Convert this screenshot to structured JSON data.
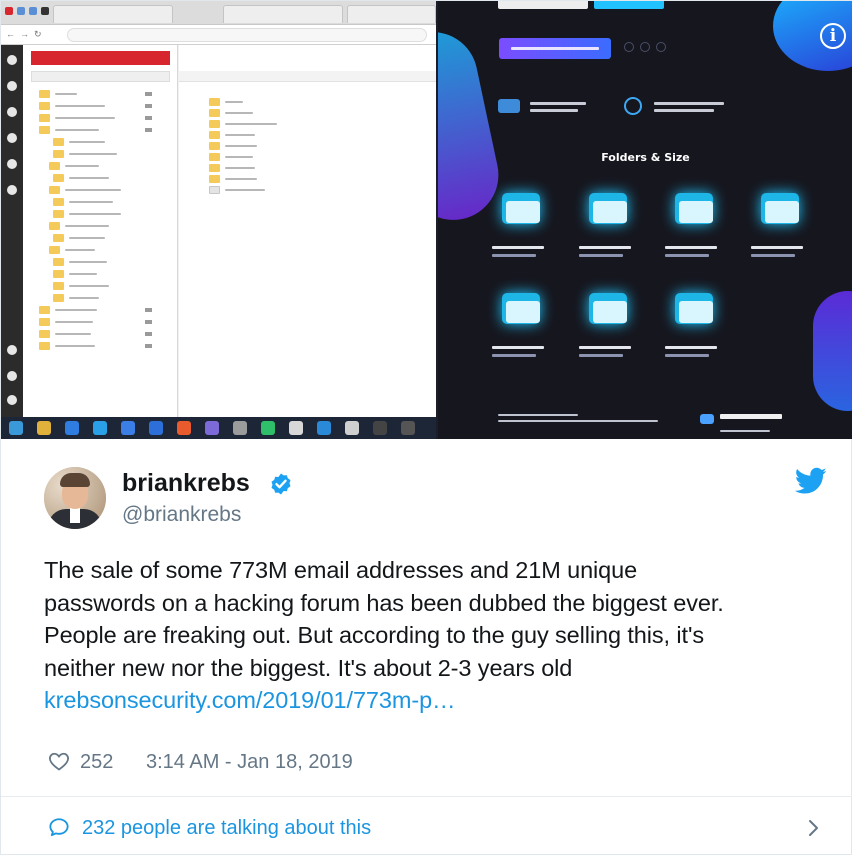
{
  "tweet": {
    "display_name": "briankrebs",
    "handle": "@briankrebs",
    "text_lines": [
      "The sale of some 773M email addresses and 21M unique",
      "passwords on a hacking forum has been dubbed the biggest ever.",
      "People are freaking out. But according to the guy selling this, it's",
      "neither new nor the biggest. It's about 2-3 years old"
    ],
    "link": "krebsonsecurity.com/2019/01/773m-p…",
    "likes": "252",
    "timestamp": "3:14 AM - Jan 18, 2019",
    "talking": "232 people are talking about this"
  },
  "media": {
    "promo_heading": "Folders & Size"
  },
  "icons": {
    "avatar": "avatar",
    "verified": "verified-badge-icon",
    "twitter": "twitter-bird-icon",
    "like": "heart-icon",
    "reply": "speech-bubble-icon",
    "more": "chevron-right-icon",
    "info": "info-icon"
  },
  "colors": {
    "text": "#14171a",
    "secondary": "#657786",
    "link": "#1b95e0",
    "verified": "#1da1f2",
    "twitter": "#1da1f2",
    "divider": "#e6ecf0",
    "promo_bg": "#16161e",
    "promo_accent": "#1db6e6"
  }
}
